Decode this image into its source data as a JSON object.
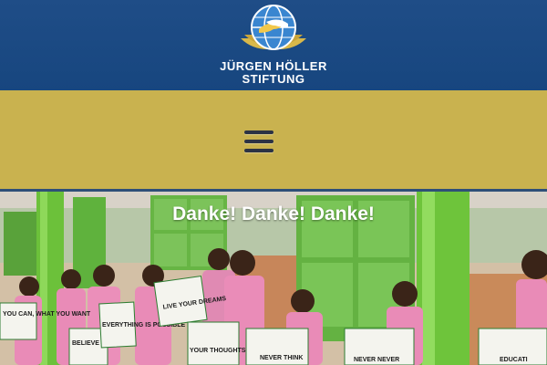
{
  "header": {
    "logo_icon": "globe-hands-icon",
    "logo_line1": "JÜRGEN HÖLLER",
    "logo_line2": "STIFTUNG"
  },
  "nav": {
    "menu_icon": "hamburger-menu-icon"
  },
  "hero": {
    "title": "Danke! Danke! Danke!",
    "signs": [
      "YOU CAN, WHAT YOU WANT",
      "BELIEVE IN YOU",
      "EVERYTHING IS POSSIBLE",
      "LIVE YOUR DREAMS",
      "YOUR THOUGHTS ARE YOUR",
      "NEVER THINK",
      "NEVER NEVER",
      "EDUCATI"
    ]
  },
  "colors": {
    "header_bg": "#1c4a84",
    "nav_bg": "#c9b24f",
    "pillar_green": "#6cc13a",
    "uniform_pink": "#e98bb7"
  }
}
